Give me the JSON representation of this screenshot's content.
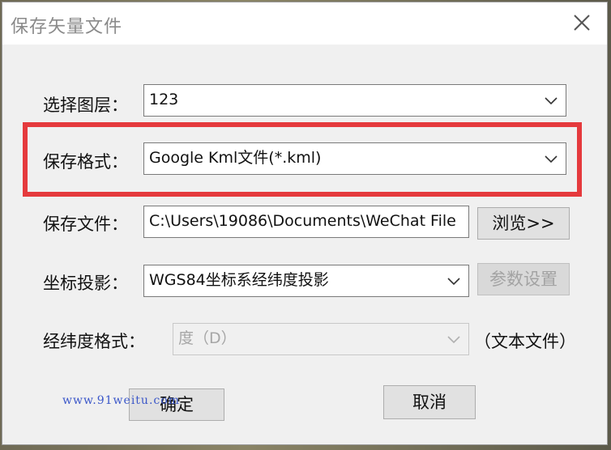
{
  "dialog": {
    "title": "保存矢量文件"
  },
  "rows": {
    "layer": {
      "label": "选择图层：",
      "value": "123"
    },
    "format": {
      "label": "保存格式：",
      "value": "Google Kml文件(*.kml)"
    },
    "file": {
      "label": "保存文件：",
      "value": "C:\\Users\\19086\\Documents\\WeChat File",
      "browse_label": "浏览>>"
    },
    "projection": {
      "label": "坐标投影：",
      "value": "WGS84坐标系经纬度投影",
      "params_label": "参数设置"
    },
    "latlon_format": {
      "label": "经纬度格式：",
      "value": "度（D）",
      "suffix": "（文本文件）"
    }
  },
  "buttons": {
    "ok_label": "确定",
    "cancel_label": "取消"
  },
  "watermark": "www.91weitu.com",
  "colors": {
    "highlight": "#e53a3d",
    "watermark": "#3b57c9"
  },
  "icons": {
    "close": "close-icon",
    "dropdown": "chevron-down-icon"
  }
}
